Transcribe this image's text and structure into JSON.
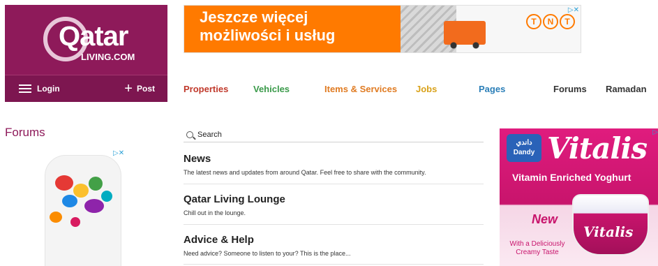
{
  "brand": {
    "logo_main": "Qatar",
    "logo_sub": "LIVING.COM",
    "login_label": "Login",
    "post_label": "Post"
  },
  "top_ad": {
    "line1": "Jeszcze więcej",
    "line2": "możliwości i usług",
    "tnt_letters": [
      "T",
      "N",
      "T"
    ],
    "adchoice": "▷✕"
  },
  "nav": {
    "items": [
      {
        "label": "Properties",
        "color": "#c0392b"
      },
      {
        "label": "Vehicles",
        "color": "#3a9a4a"
      },
      {
        "label": "Items & Services",
        "color": "#e07b22"
      },
      {
        "label": "Jobs",
        "color": "#d9a21b"
      },
      {
        "label": "Pages",
        "color": "#2b7fb8"
      },
      {
        "label": "Forums",
        "color": "#333333"
      },
      {
        "label": "Ramadan",
        "color": "#333333"
      }
    ]
  },
  "page": {
    "title": "Forums"
  },
  "search": {
    "placeholder": "Search"
  },
  "forums": [
    {
      "title": "News",
      "description": "The latest news and updates from around Qatar. Feel free to share with the community."
    },
    {
      "title": "Qatar Living Lounge",
      "description": "Chill out in the lounge."
    },
    {
      "title": "Advice & Help",
      "description": "Need advice? Someone to listen to your? This is the place..."
    }
  ],
  "left_ad": {
    "adchoice": "▷✕"
  },
  "right_ad": {
    "brand": "دandy Dandy",
    "brand_ar": "داندي",
    "brand_en": "Dandy",
    "product": "Vitalis",
    "tagline": "Vitamin Enriched Yoghurt",
    "new_label": "New",
    "cup_label": "Vitalis",
    "taste_line1": "With a Deliciously",
    "taste_line2": "Creamy Taste",
    "adchoice": "▷"
  }
}
